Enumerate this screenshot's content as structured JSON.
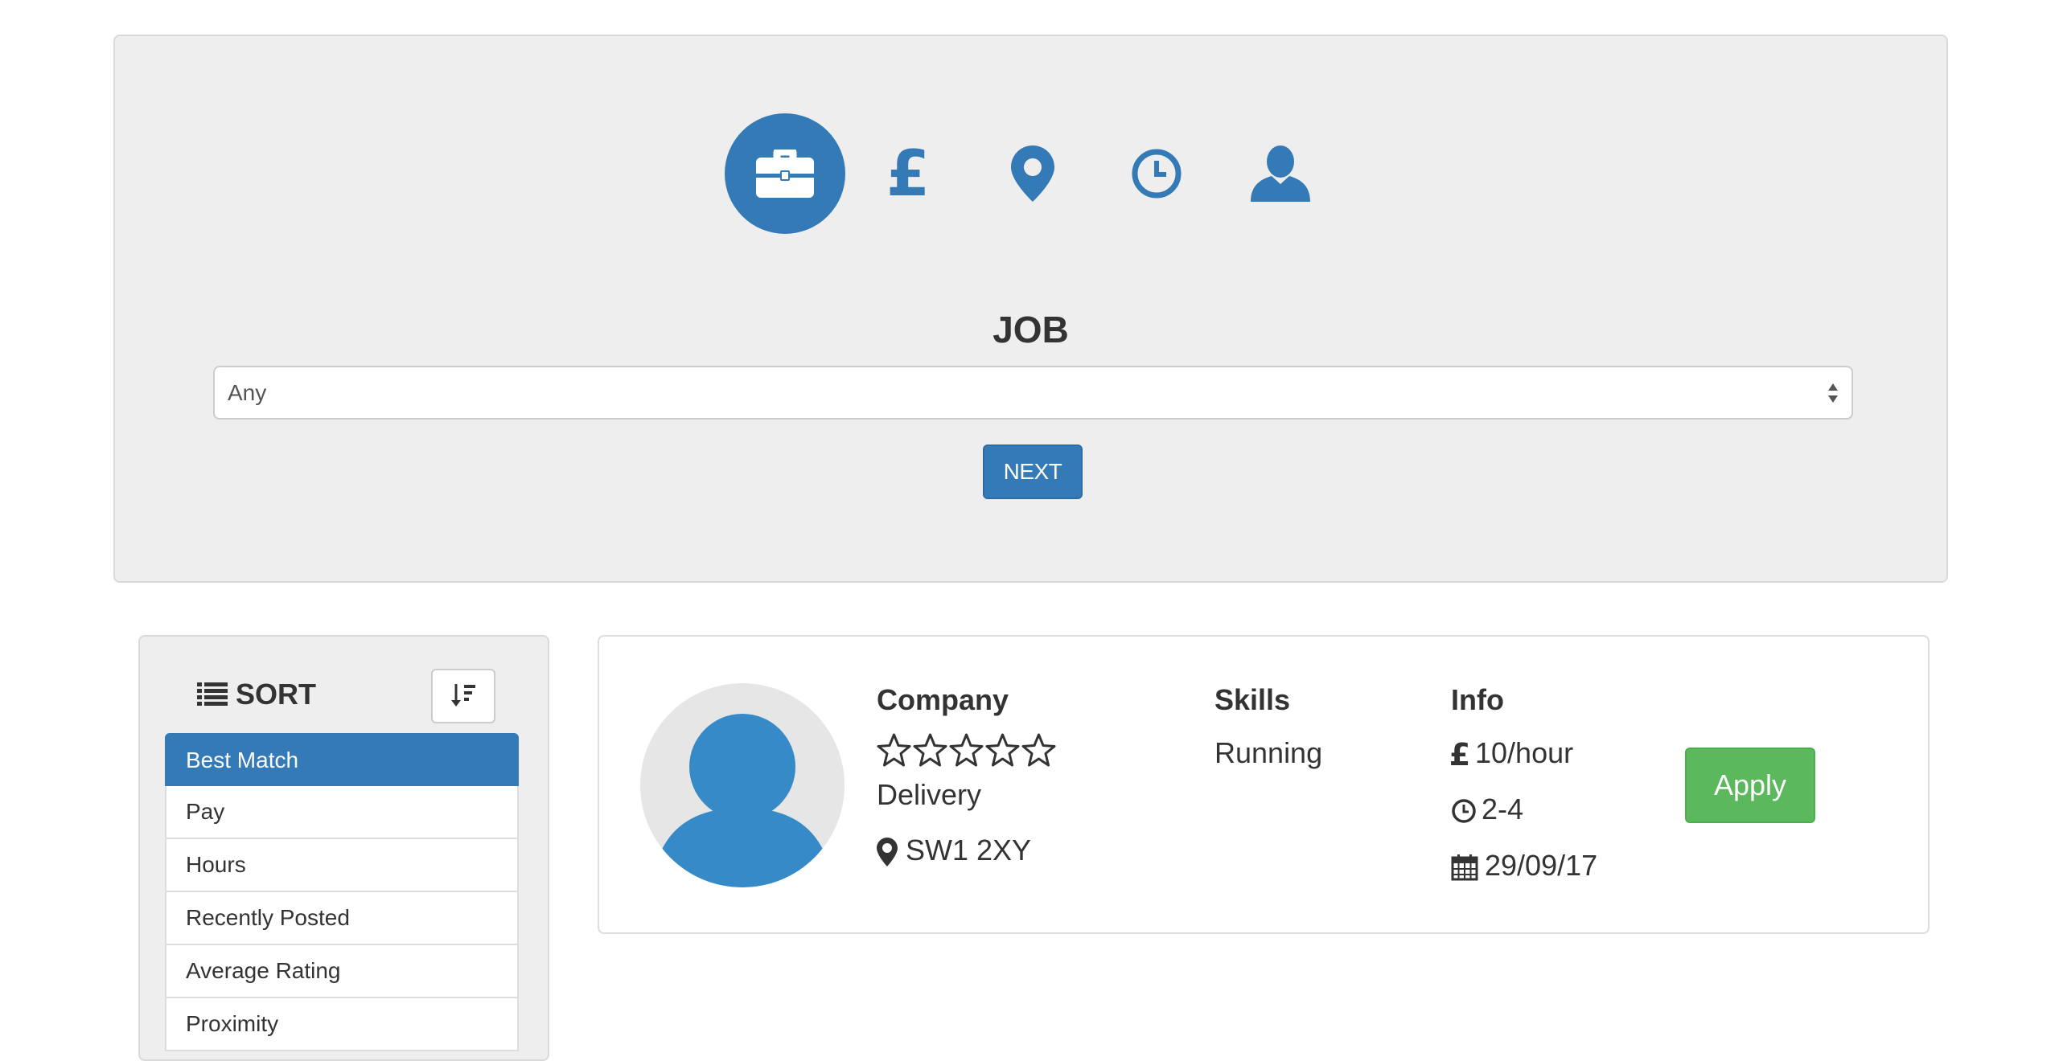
{
  "wizard": {
    "steps": [
      {
        "name": "job",
        "icon": "briefcase-icon",
        "active": true
      },
      {
        "name": "pay",
        "icon": "pound-icon",
        "active": false
      },
      {
        "name": "location",
        "icon": "map-marker-icon",
        "active": false
      },
      {
        "name": "time",
        "icon": "clock-icon",
        "active": false
      },
      {
        "name": "profile",
        "icon": "user-icon",
        "active": false
      }
    ],
    "title": "JOB",
    "select_value": "Any",
    "next_label": "NEXT",
    "accent_color": "#337ab7"
  },
  "sort": {
    "heading": "SORT",
    "options": [
      {
        "label": "Best Match",
        "active": true
      },
      {
        "label": "Pay",
        "active": false
      },
      {
        "label": "Hours",
        "active": false
      },
      {
        "label": "Recently Posted",
        "active": false
      },
      {
        "label": "Average Rating",
        "active": false
      },
      {
        "label": "Proximity",
        "active": false
      }
    ]
  },
  "job": {
    "company_heading": "Company",
    "rating": 0,
    "rating_max": 5,
    "category": "Delivery",
    "postcode": "SW1 2XY",
    "skills_heading": "Skills",
    "skills": "Running",
    "info_heading": "Info",
    "pay": "10/hour",
    "hours": "2-4",
    "date": "29/09/17",
    "apply_label": "Apply",
    "apply_color": "#5cb85c"
  }
}
